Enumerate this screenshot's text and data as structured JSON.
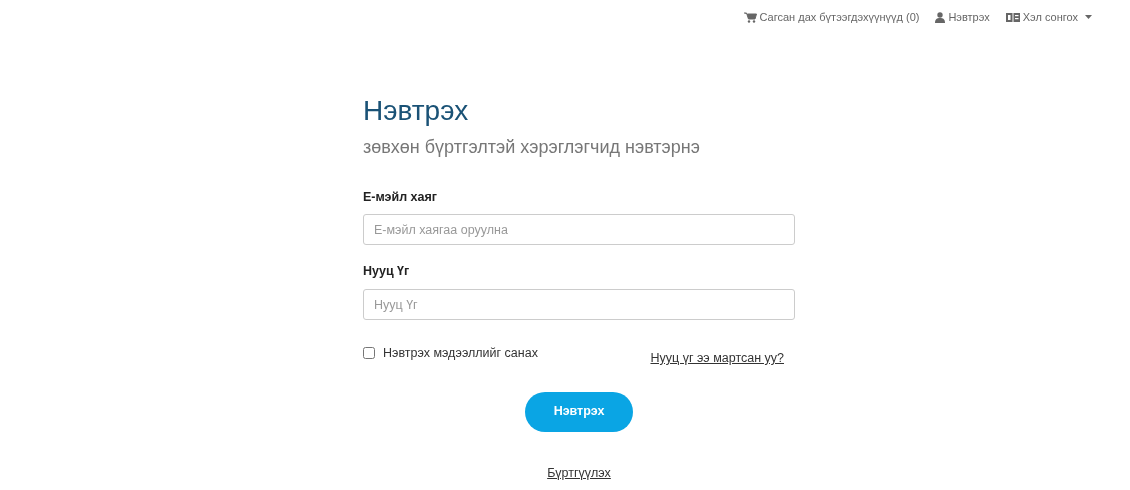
{
  "top_nav": [
    {
      "kind": "cart",
      "label": "Сагсан дах бүтээгдэхүүнүүд (0)"
    },
    {
      "kind": "user",
      "label": "Нэвтрэх"
    },
    {
      "kind": "language",
      "label": "Хэл сонгох",
      "dropdown": true
    }
  ],
  "title": "Нэвтрэх",
  "subtitle": "зөвхөн бүртгэлтэй хэрэглэгчид нэвтэрнэ",
  "fields": [
    {
      "label": "Е-мэйл хаяг",
      "placeholder": "Е-мэйл хаягаа оруулна"
    },
    {
      "label": "Нууц Үг",
      "placeholder": "Нууц Үг"
    }
  ],
  "remember": {
    "label": "Нэвтрэх мэдээллийг санах",
    "checked": false
  },
  "forgot_link": "Нууц үг ээ мартсан уу?",
  "submit_button": "Нэвтрэх",
  "register_link": "Бүртгүүлэх"
}
